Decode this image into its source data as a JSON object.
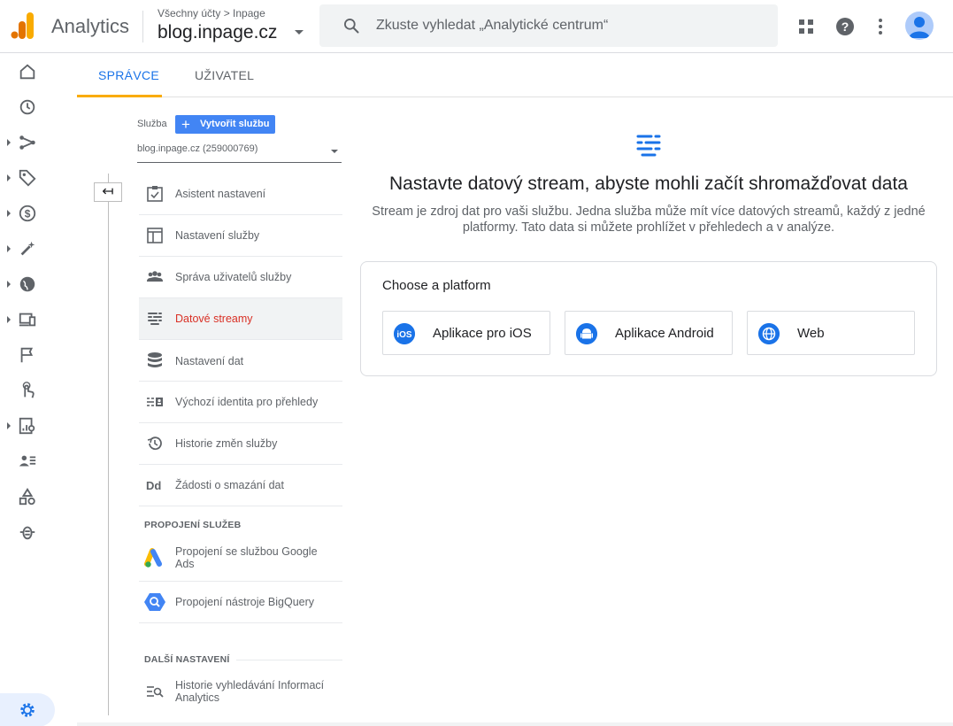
{
  "topbar": {
    "brand": "Analytics",
    "breadcrumb": "Všechny účty > Inpage",
    "property": "blog.inpage.cz",
    "search_placeholder": "Zkuste vyhledat „Analytické centrum“"
  },
  "tabs": {
    "admin": "SPRÁVCE",
    "user": "UŽIVATEL"
  },
  "service": {
    "label": "Služba",
    "create_button": "Vytvořit službu",
    "selected": "blog.inpage.cz (259000769)"
  },
  "menu": {
    "items": [
      {
        "label": "Asistent nastavení",
        "icon": "checklist-icon"
      },
      {
        "label": "Nastavení služby",
        "icon": "layout-icon"
      },
      {
        "label": "Správa uživatelů služby",
        "icon": "people-icon"
      },
      {
        "label": "Datové streamy",
        "icon": "data-streams-icon"
      },
      {
        "label": "Nastavení dat",
        "icon": "database-icon"
      },
      {
        "label": "Výchozí identita pro přehledy",
        "icon": "identity-icon"
      },
      {
        "label": "Historie změn služby",
        "icon": "history-icon"
      },
      {
        "label": "Žádosti o smazání dat",
        "icon": "dd-icon"
      }
    ],
    "section_links": "PROPOJENÍ SLUŽEB",
    "links": [
      {
        "label": "Propojení se službou Google Ads",
        "icon": "google-ads-icon"
      },
      {
        "label": "Propojení nástroje BigQuery",
        "icon": "bigquery-icon"
      }
    ],
    "section_more": "DALŠÍ NASTAVENÍ",
    "more": [
      {
        "label": "Historie vyhledávání Informací Analytics",
        "icon": "search-history-icon"
      }
    ]
  },
  "main": {
    "heading": "Nastavte datový stream, abyste mohli začít shromažďovat data",
    "subtext": "Stream je zdroj dat pro vaši službu. Jedna služba může mít více datových streamů, každý z jedné platformy. Tato data si můžete prohlížet v přehledech a v analýze.",
    "choose": "Choose a platform",
    "platforms": [
      {
        "label": "Aplikace pro iOS",
        "icon": "ios-icon"
      },
      {
        "label": "Aplikace Android",
        "icon": "android-icon"
      },
      {
        "label": "Web",
        "icon": "globe-icon"
      }
    ]
  },
  "colors": {
    "accent": "#1a73e8",
    "active_text": "#d93025",
    "tab_underline": "#f9ab00",
    "create_button": "#4285f4"
  }
}
